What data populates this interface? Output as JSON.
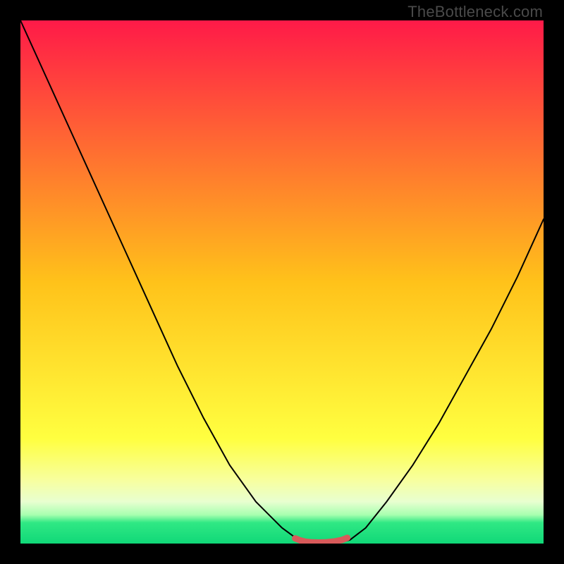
{
  "watermark": "TheBottleneck.com",
  "colors": {
    "curve": "#000000",
    "marker": "#d85a5a",
    "bg_black": "#000000"
  },
  "chart_data": {
    "type": "line",
    "title": "",
    "xlabel": "",
    "ylabel": "",
    "xlim": [
      0,
      100
    ],
    "ylim": [
      0,
      100
    ],
    "gradient": {
      "stops": [
        {
          "offset": 0.0,
          "color": "#ff1a48"
        },
        {
          "offset": 0.5,
          "color": "#ffc21a"
        },
        {
          "offset": 0.8,
          "color": "#ffff40"
        },
        {
          "offset": 0.88,
          "color": "#f7ffa0"
        },
        {
          "offset": 0.92,
          "color": "#e8ffd0"
        },
        {
          "offset": 0.945,
          "color": "#a8ffb0"
        },
        {
          "offset": 0.96,
          "color": "#30e884"
        },
        {
          "offset": 1.0,
          "color": "#10d878"
        }
      ]
    },
    "series": [
      {
        "name": "bottleneck-curve",
        "x": [
          0,
          5,
          10,
          15,
          20,
          25,
          30,
          35,
          40,
          45,
          50,
          53,
          55,
          58,
          61,
          63,
          66,
          70,
          75,
          80,
          85,
          90,
          95,
          100
        ],
        "y": [
          100,
          89,
          78,
          67,
          56,
          45,
          34,
          24,
          15,
          8,
          3,
          0.8,
          0.2,
          0.1,
          0.2,
          0.7,
          3,
          8,
          15,
          23,
          32,
          41,
          51,
          62
        ]
      }
    ],
    "markers": {
      "name": "highlight-band",
      "x": [
        52.5,
        53.5,
        54.5,
        55.5,
        57,
        58.5,
        60,
        61.5,
        62.5
      ],
      "y": [
        1.0,
        0.6,
        0.35,
        0.25,
        0.2,
        0.25,
        0.4,
        0.7,
        1.1
      ]
    }
  }
}
